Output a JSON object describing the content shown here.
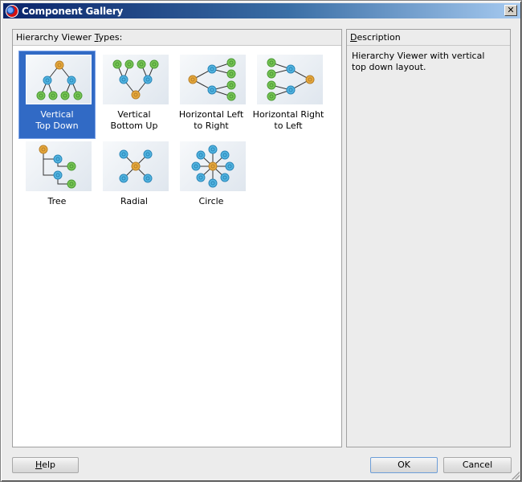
{
  "window": {
    "title": "Component Gallery",
    "close_label": "✕"
  },
  "left_panel": {
    "header_prefix": "Hierarchy Viewer ",
    "header_mnemonic": "T",
    "header_suffix": "ypes:",
    "items": [
      {
        "label": "Vertical\nTop Down",
        "icon": "vertical-top-down-icon",
        "selected": true
      },
      {
        "label": "Vertical\nBottom Up",
        "icon": "vertical-bottom-up-icon",
        "selected": false
      },
      {
        "label": "Horizontal Left\nto Right",
        "icon": "horizontal-left-to-right-icon",
        "selected": false
      },
      {
        "label": "Horizontal Right\nto Left",
        "icon": "horizontal-right-to-left-icon",
        "selected": false
      },
      {
        "label": "Tree",
        "icon": "tree-icon",
        "selected": false
      },
      {
        "label": "Radial",
        "icon": "radial-icon",
        "selected": false
      },
      {
        "label": "Circle",
        "icon": "circle-icon",
        "selected": false
      }
    ]
  },
  "right_panel": {
    "header_mnemonic": "D",
    "header_suffix": "escription",
    "description": "Hierarchy Viewer with vertical\ntop down layout."
  },
  "buttons": {
    "help_mnemonic": "H",
    "help_suffix": "elp",
    "ok": "OK",
    "cancel": "Cancel"
  },
  "colors": {
    "selection": "#316ac5",
    "node_root": "#e0a040",
    "node_mid": "#4aaed8",
    "node_leaf": "#6cbf4c"
  }
}
